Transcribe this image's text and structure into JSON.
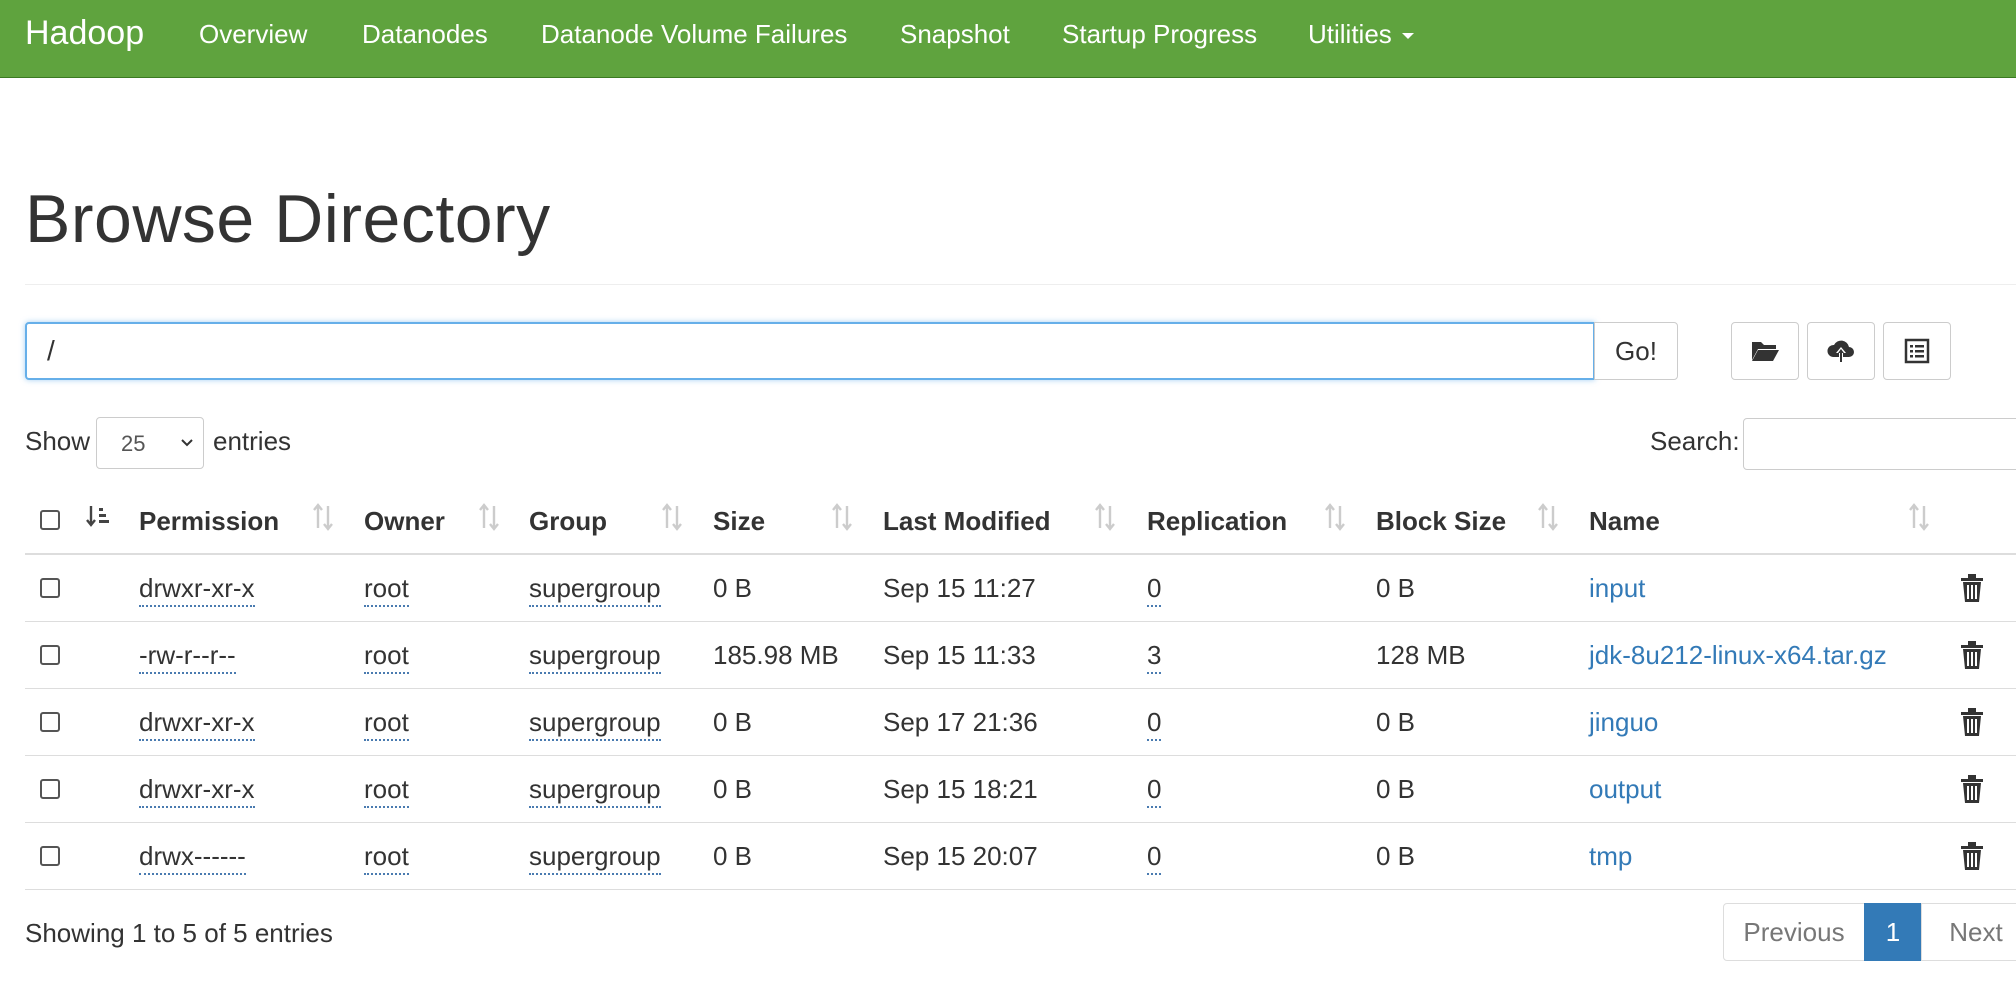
{
  "navbar": {
    "brand": "Hadoop",
    "items": [
      "Overview",
      "Datanodes",
      "Datanode Volume Failures",
      "Snapshot",
      "Startup Progress",
      "Utilities"
    ]
  },
  "page": {
    "title": "Browse Directory"
  },
  "path_bar": {
    "value": "/",
    "go_label": "Go!"
  },
  "toolbar": {
    "icons": [
      "folder-open-icon",
      "cloud-upload-icon",
      "list-icon"
    ]
  },
  "table_controls": {
    "show_label": "Show",
    "page_length": "25",
    "entries_label": "entries",
    "search_label": "Search:",
    "search_value": ""
  },
  "table": {
    "columns": [
      "Permission",
      "Owner",
      "Group",
      "Size",
      "Last Modified",
      "Replication",
      "Block Size",
      "Name"
    ],
    "rows": [
      {
        "permission": "drwxr-xr-x",
        "owner": "root",
        "group": "supergroup",
        "size": "0 B",
        "modified": "Sep 15 11:27",
        "replication": "0",
        "block_size": "0 B",
        "name": "input"
      },
      {
        "permission": "-rw-r--r--",
        "owner": "root",
        "group": "supergroup",
        "size": "185.98 MB",
        "modified": "Sep 15 11:33",
        "replication": "3",
        "block_size": "128 MB",
        "name": "jdk-8u212-linux-x64.tar.gz"
      },
      {
        "permission": "drwxr-xr-x",
        "owner": "root",
        "group": "supergroup",
        "size": "0 B",
        "modified": "Sep 17 21:36",
        "replication": "0",
        "block_size": "0 B",
        "name": "jinguo"
      },
      {
        "permission": "drwxr-xr-x",
        "owner": "root",
        "group": "supergroup",
        "size": "0 B",
        "modified": "Sep 15 18:21",
        "replication": "0",
        "block_size": "0 B",
        "name": "output"
      },
      {
        "permission": "drwx------",
        "owner": "root",
        "group": "supergroup",
        "size": "0 B",
        "modified": "Sep 15 20:07",
        "replication": "0",
        "block_size": "0 B",
        "name": "tmp"
      }
    ]
  },
  "footer": {
    "info": "Showing 1 to 5 of 5 entries",
    "previous_label": "Previous",
    "current_page": "1",
    "next_label": "Next"
  },
  "colors": {
    "navbar": "#5fa33e",
    "link": "#337ab7",
    "active_page": "#337ab7"
  }
}
